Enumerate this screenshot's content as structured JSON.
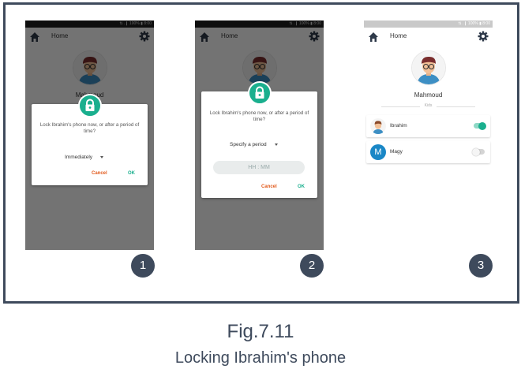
{
  "statusbar": {
    "text": "⇅ .❙ 100% ▮ 8:00"
  },
  "appbar": {
    "title": "Home"
  },
  "parent": {
    "name": "Mahmoud"
  },
  "step1": {
    "message": "Lock Ibrahim's phone now, or after a period of time?",
    "selected_option": "Immediately",
    "cancel_label": "Cancel",
    "ok_label": "OK",
    "number": "1"
  },
  "step2": {
    "message": "Lock Ibrahim's phone now, or after a period of time?",
    "selected_option": "Specify a period",
    "time_placeholder": "HH  :  MM",
    "cancel_label": "Cancel",
    "ok_label": "OK",
    "number": "2"
  },
  "step3": {
    "kids_label": "Kids",
    "kids": [
      {
        "name": "Ibrahim",
        "avatar": "boy-avatar-icon",
        "locked": true
      },
      {
        "name": "Magy",
        "avatar_letter": "M",
        "locked": false
      }
    ],
    "number": "3"
  },
  "caption": {
    "figure": "Fig.7.11",
    "title": "Locking Ibrahim's phone"
  },
  "colors": {
    "accent": "#1aaf8e",
    "cancel": "#e25b1d",
    "frame": "#3e4a5c",
    "letter_avatar": "#1a87c6"
  }
}
